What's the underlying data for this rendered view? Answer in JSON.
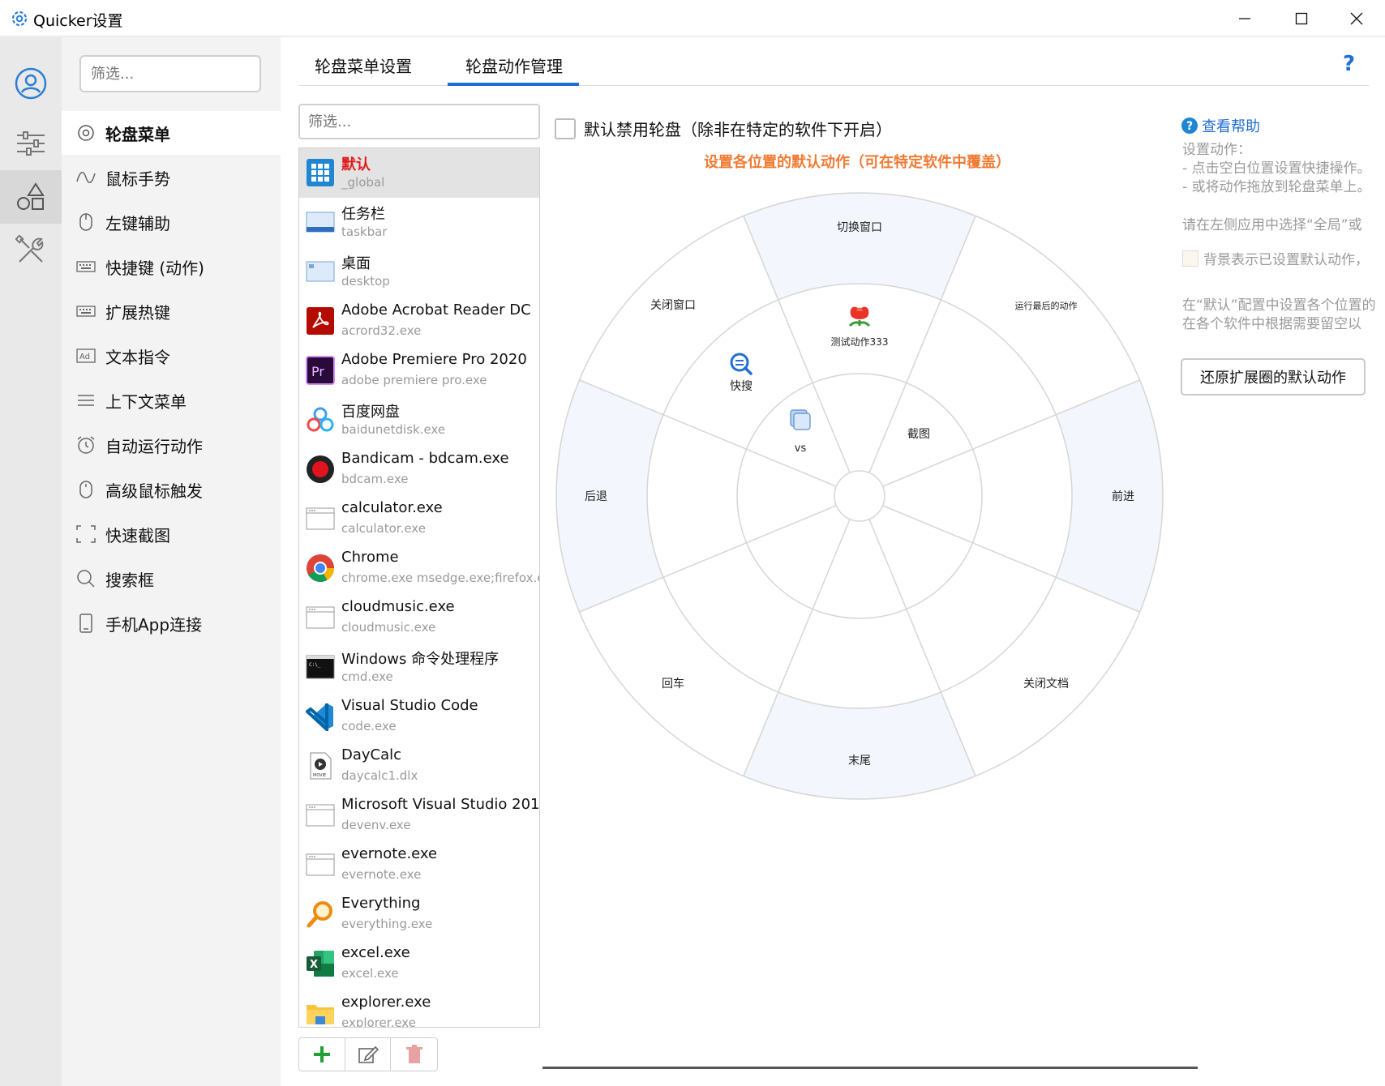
{
  "window": {
    "title": "Quicker设置"
  },
  "nav": {
    "filter_placeholder": "筛选...",
    "items": [
      {
        "label": "轮盘菜单",
        "icon": "radio-circle-icon"
      },
      {
        "label": "鼠标手势",
        "icon": "wave-icon"
      },
      {
        "label": "左键辅助",
        "icon": "mouse-icon"
      },
      {
        "label": "快捷键 (动作)",
        "icon": "keyboard-icon"
      },
      {
        "label": "扩展热键",
        "icon": "keyboard-icon"
      },
      {
        "label": "文本指令",
        "icon": "ad-icon"
      },
      {
        "label": "上下文菜单",
        "icon": "hamburger-icon"
      },
      {
        "label": "自动运行动作",
        "icon": "alarm-icon"
      },
      {
        "label": "高级鼠标触发",
        "icon": "mouse-icon"
      },
      {
        "label": "快速截图",
        "icon": "crop-icon"
      },
      {
        "label": "搜索框",
        "icon": "search-icon"
      },
      {
        "label": "手机App连接",
        "icon": "phone-icon"
      }
    ]
  },
  "tabs": [
    {
      "label": "轮盘菜单设置"
    },
    {
      "label": "轮盘动作管理"
    }
  ],
  "help_symbol": "?",
  "apps": {
    "filter_placeholder": "筛选...",
    "items": [
      {
        "name": "默认",
        "proc": "_global"
      },
      {
        "name": "任务栏",
        "proc": "taskbar"
      },
      {
        "name": "桌面",
        "proc": "desktop"
      },
      {
        "name": "Adobe Acrobat Reader DC",
        "proc": "acrord32.exe"
      },
      {
        "name": "Adobe Premiere Pro 2020",
        "proc": "adobe premiere pro.exe"
      },
      {
        "name": "百度网盘",
        "proc": "baidunetdisk.exe"
      },
      {
        "name": "Bandicam - bdcam.exe",
        "proc": "bdcam.exe"
      },
      {
        "name": "calculator.exe",
        "proc": "calculator.exe"
      },
      {
        "name": "Chrome",
        "proc": "chrome.exe  msedge.exe;firefox.e"
      },
      {
        "name": "cloudmusic.exe",
        "proc": "cloudmusic.exe"
      },
      {
        "name": "Windows 命令处理程序",
        "proc": "cmd.exe"
      },
      {
        "name": "Visual Studio Code",
        "proc": "code.exe"
      },
      {
        "name": "DayCalc",
        "proc": "daycalc1.dlx"
      },
      {
        "name": "Microsoft Visual Studio 201",
        "proc": "devenv.exe"
      },
      {
        "name": "evernote.exe",
        "proc": "evernote.exe"
      },
      {
        "name": "Everything",
        "proc": "everything.exe"
      },
      {
        "name": "excel.exe",
        "proc": "excel.exe"
      },
      {
        "name": "explorer.exe",
        "proc": "explorer.exe"
      }
    ]
  },
  "settings": {
    "disable_wheel_label": "默认禁用轮盘（除非在特定的软件下开启）",
    "wheel_caption": "设置各位置的默认动作（可在特定软件中覆盖）"
  },
  "wheel": {
    "outer": [
      "切换窗口",
      "运行最后的动作",
      "前进",
      "关闭文档",
      "末尾",
      "回车",
      "后退",
      "关闭窗口"
    ],
    "inner": [
      "测试动作333",
      "截图",
      "",
      "",
      "",
      "",
      "",
      "快搜"
    ],
    "innermost": "vs"
  },
  "info": {
    "help_link": "查看帮助",
    "lines": [
      "设置动作：",
      "- 点击空白位置设置快捷操作。",
      "- 或将动作拖放到轮盘菜单上。",
      "请在左侧应用中选择“全局”或",
      "背景表示已设置默认动作，",
      "在“默认”配置中设置各个位置的",
      "在各个软件中根据需要留空以"
    ],
    "restore_button": "还原扩展圈的默认动作"
  }
}
